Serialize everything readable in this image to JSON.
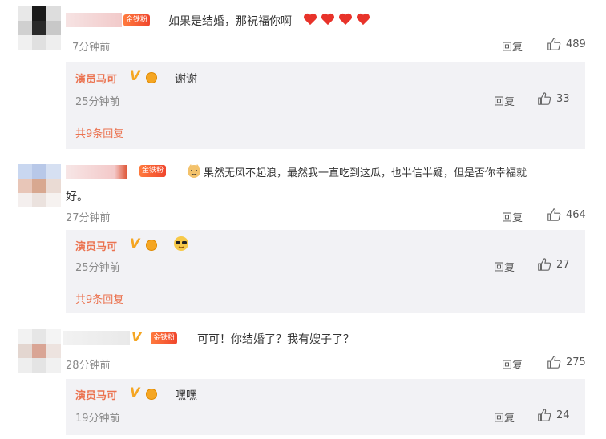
{
  "colors": {
    "accent": "#eb7350",
    "meta": "#8a8a8a",
    "reply_bg": "#f2f2f5",
    "vip": "#f5a623"
  },
  "comments": [
    {
      "badge": "金铁粉",
      "text": "如果是结婚，那祝福你啊",
      "time": "7分钟前",
      "reply_label": "回复",
      "likes": "489",
      "reply": {
        "name": "演员马可",
        "vip": "V",
        "text": "谢谢",
        "time": "25分钟前",
        "reply_label": "回复",
        "likes": "33"
      },
      "more": "共9条回复"
    },
    {
      "badge": "金铁粉",
      "text_line1": "果然无风不起浪，最然我一直吃到这瓜，也半信半疑，但是否你幸福就",
      "text_line2": "好。",
      "time": "27分钟前",
      "reply_label": "回复",
      "likes": "464",
      "reply": {
        "name": "演员马可",
        "vip": "V",
        "text": "",
        "time": "25分钟前",
        "reply_label": "回复",
        "likes": "27"
      },
      "more": "共9条回复"
    },
    {
      "badge": "金铁粉",
      "text": "可可！你结婚了？我有嫂子了？",
      "time": "28分钟前",
      "reply_label": "回复",
      "likes": "275",
      "reply": {
        "name": "演员马可",
        "vip": "V",
        "text": "嘿嘿",
        "time": "19分钟前",
        "reply_label": "回复",
        "likes": "24"
      }
    }
  ]
}
